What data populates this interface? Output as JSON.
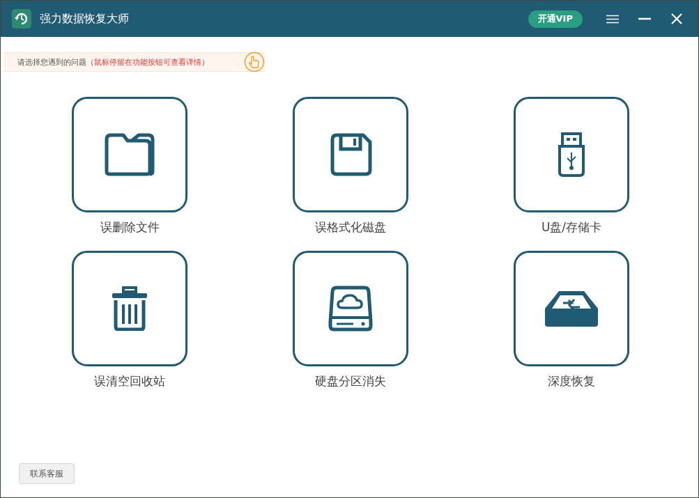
{
  "window": {
    "title": "强力数据恢复大师",
    "vip_button": "开通VIP"
  },
  "hint": {
    "text": "请选择您遇到的问题（",
    "highlight": "鼠标停留在功能按钮可查看详情",
    "close_paren": "）"
  },
  "options": [
    {
      "kind": "folder",
      "label": "误删除文件"
    },
    {
      "kind": "floppy",
      "label": "误格式化磁盘"
    },
    {
      "kind": "usb",
      "label": "U盘/存储卡"
    },
    {
      "kind": "trash",
      "label": "误清空回收站"
    },
    {
      "kind": "disk",
      "label": "硬盘分区消失"
    },
    {
      "kind": "tray",
      "label": "深度恢复"
    }
  ],
  "support_button": "联系客服"
}
